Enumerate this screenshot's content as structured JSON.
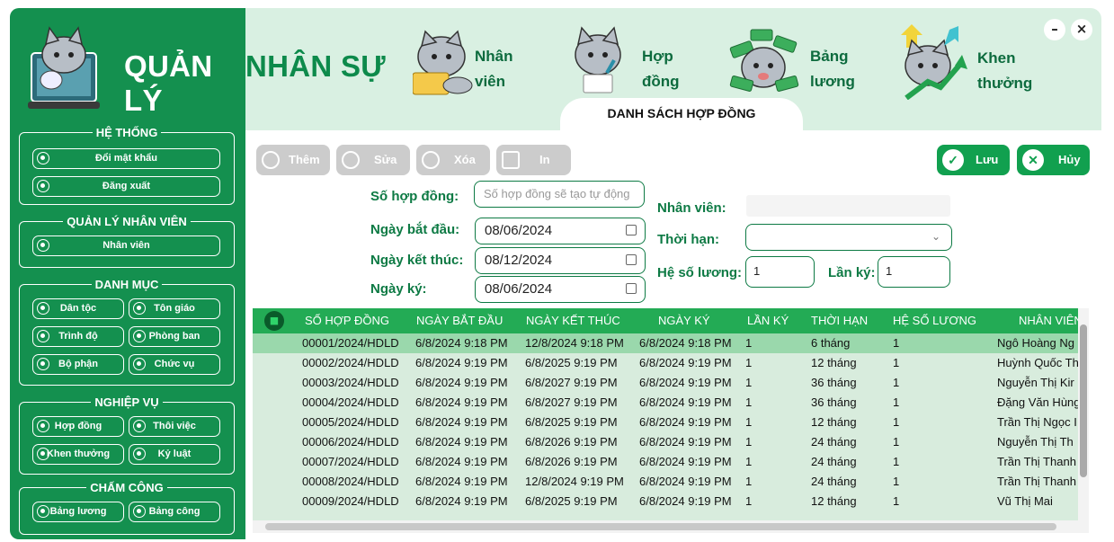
{
  "app": {
    "title_white": "QUẢN LÝ",
    "title_green": "NHÂN SỰ"
  },
  "nav": [
    {
      "line1": "Nhân",
      "line2": "viên"
    },
    {
      "line1": "Hợp",
      "line2": "đồng"
    },
    {
      "line1": "Bảng",
      "line2": "lương"
    },
    {
      "line1": "Khen",
      "line2": "thưởng"
    }
  ],
  "active_tab": "DANH SÁCH HỢP ĐỒNG",
  "window": {
    "minimize": "–",
    "close": "×"
  },
  "sidebar": {
    "groups": [
      {
        "title": "HỆ THỐNG",
        "items": [
          "Đổi mật khẩu",
          "Đăng xuất"
        ]
      },
      {
        "title": "QUẢN LÝ NHÂN VIÊN",
        "items": [
          "Nhân viên"
        ]
      },
      {
        "title": "DANH MỤC",
        "items": [
          "Dân tộc",
          "Tôn giáo",
          "Trình độ",
          "Phòng ban",
          "Bộ phận",
          "Chức vụ"
        ]
      },
      {
        "title": "NGHIỆP VỤ",
        "items": [
          "Hợp đồng",
          "Thôi việc",
          "Khen thưởng",
          "Kỷ luật"
        ]
      },
      {
        "title": "CHẤM CÔNG",
        "items": [
          "Bảng lương",
          "Bảng công"
        ]
      }
    ]
  },
  "toolbar": {
    "add": "Thêm",
    "edit": "Sửa",
    "delete": "Xóa",
    "print": "In",
    "save": "Lưu",
    "cancel": "Hủy"
  },
  "form": {
    "contract_no_label": "Số hợp đồng:",
    "contract_no_placeholder": "Số hợp đồng sẽ tạo tự động",
    "start_label": "Ngày bắt đầu:",
    "start_value": "08/06/2024",
    "end_label": "Ngày kết thúc:",
    "end_value": "08/12/2024",
    "sign_label": "Ngày ký:",
    "sign_value": "08/06/2024",
    "employee_label": "Nhân viên:",
    "term_label": "Thời hạn:",
    "coef_label": "Hệ số lương:",
    "coef_value": "1",
    "times_label": "Lần ký:",
    "times_value": "1"
  },
  "table": {
    "columns": [
      "SỐ HỢP ĐỒNG",
      "NGÀY BẮT ĐẦU",
      "NGÀY KẾT THÚC",
      "NGÀY KÝ",
      "LẦN KÝ",
      "THỜI HẠN",
      "HỆ SỐ LƯƠNG",
      "NHÂN VIÊN"
    ],
    "rows": [
      [
        "00001/2024/HDLD",
        "6/8/2024 9:18 PM",
        "12/8/2024 9:18 PM",
        "6/8/2024 9:18 PM",
        "1",
        "6 tháng",
        "1",
        "Ngô Hoàng Ng"
      ],
      [
        "00002/2024/HDLD",
        "6/8/2024 9:19 PM",
        "6/8/2025 9:19 PM",
        "6/8/2024 9:19 PM",
        "1",
        "12 tháng",
        "1",
        "Huỳnh Quốc Th"
      ],
      [
        "00003/2024/HDLD",
        "6/8/2024 9:19 PM",
        "6/8/2027 9:19 PM",
        "6/8/2024 9:19 PM",
        "1",
        "36 tháng",
        "1",
        "Nguyễn Thị Kir"
      ],
      [
        "00004/2024/HDLD",
        "6/8/2024 9:19 PM",
        "6/8/2027 9:19 PM",
        "6/8/2024 9:19 PM",
        "1",
        "36 tháng",
        "1",
        "Đặng Văn Hùng"
      ],
      [
        "00005/2024/HDLD",
        "6/8/2024 9:19 PM",
        "6/8/2025 9:19 PM",
        "6/8/2024 9:19 PM",
        "1",
        "12 tháng",
        "1",
        "Trần Thị Ngọc I"
      ],
      [
        "00006/2024/HDLD",
        "6/8/2024 9:19 PM",
        "6/8/2026 9:19 PM",
        "6/8/2024 9:19 PM",
        "1",
        "24 tháng",
        "1",
        "Nguyễn Thị Th"
      ],
      [
        "00007/2024/HDLD",
        "6/8/2024 9:19 PM",
        "6/8/2026 9:19 PM",
        "6/8/2024 9:19 PM",
        "1",
        "24 tháng",
        "1",
        "Trần Thị Thanh"
      ],
      [
        "00008/2024/HDLD",
        "6/8/2024 9:19 PM",
        "12/8/2024 9:19 PM",
        "6/8/2024 9:19 PM",
        "1",
        "24 tháng",
        "1",
        "Trần Thị Thanh"
      ],
      [
        "00009/2024/HDLD",
        "6/8/2024 9:19 PM",
        "6/8/2025 9:19 PM",
        "6/8/2024 9:19 PM",
        "1",
        "12 tháng",
        "1",
        "Vũ Thị Mai"
      ]
    ]
  },
  "colors": {
    "sidebar": "#14904f",
    "header": "#d9f0e2",
    "accent": "#11a04f",
    "table_head": "#23ab55",
    "selected_row": "#9ad8ac"
  }
}
